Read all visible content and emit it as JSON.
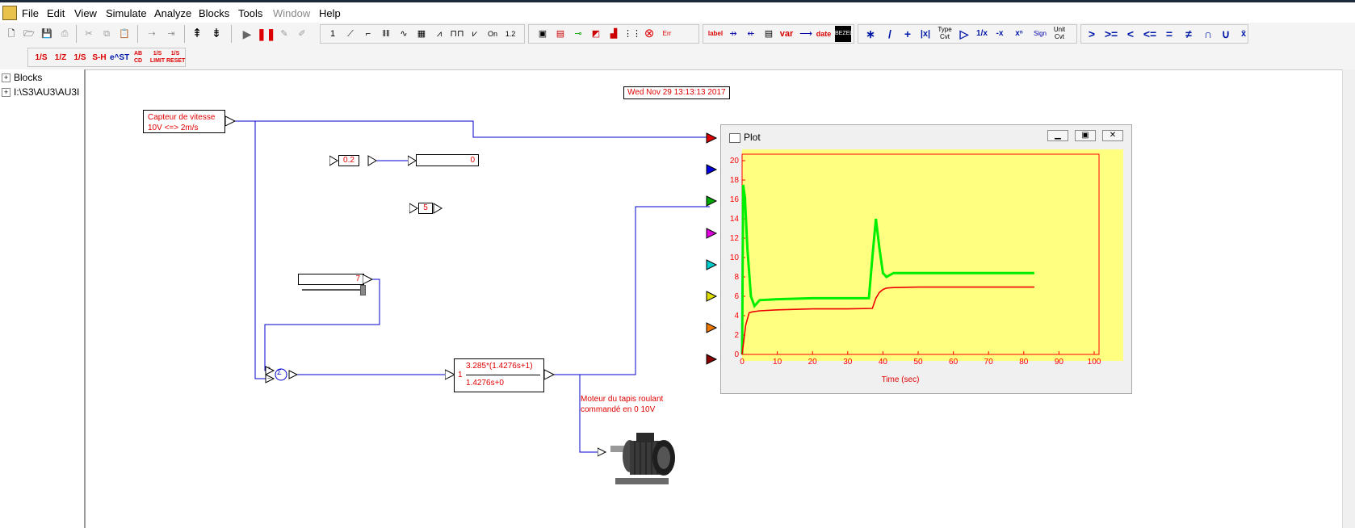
{
  "menu": {
    "items": [
      "File",
      "Edit",
      "View",
      "Simulate",
      "Analyze",
      "Blocks",
      "Tools",
      "Window",
      "Help"
    ]
  },
  "toolbar2": {
    "buttons": [
      "1/S",
      "1/Z",
      "1/S",
      "S-H",
      "e^ST",
      "AB CD",
      "1/S LIMIT",
      "1/S RESET"
    ]
  },
  "toolbar1": {
    "labels": [
      "label",
      "var",
      "date",
      "Type Cvt",
      "Sign",
      "Unit Cvt"
    ],
    "step_label": "1",
    "on_label": "On"
  },
  "tree": {
    "items": [
      {
        "label": "Blocks"
      },
      {
        "label": "I:\\S3\\AU3\\AU3I"
      }
    ]
  },
  "diagram": {
    "date_stamp": "Wed Nov 29 13:13:13 2017",
    "sensor_label_line1": "Capteur de vitesse",
    "sensor_label_line2": "10V <=> 2m/s",
    "const_a": "0.2",
    "display_value": "0",
    "const_b": "5",
    "slider_value": "7",
    "tf_prefix": "1",
    "tf_numerator": "3.285*(1.4276s+1)",
    "tf_denominator": "1.4276s+0",
    "sum_symbol": "Σ",
    "motor_label_line1": "Moteur du tapis roulant",
    "motor_label_line2": "commandé en 0 10V"
  },
  "plot": {
    "title": "Plot",
    "xlabel": "Time (sec)",
    "x_ticks": [
      "0",
      "10",
      "20",
      "30",
      "40",
      "50",
      "60",
      "70",
      "80",
      "90",
      "100"
    ],
    "y_ticks": [
      "0",
      "2",
      "4",
      "6",
      "8",
      "10",
      "12",
      "14",
      "16",
      "18",
      "20"
    ]
  },
  "colors": {
    "wire": "#0000cc",
    "plot_bg": "#ffff80",
    "plot_axis": "#ff0000",
    "series_green": "#00ee00",
    "series_red": "#ee0000",
    "port_colors": [
      "#dd0000",
      "#0000dd",
      "#00aa00",
      "#dd00dd",
      "#00cccc",
      "#dddd00",
      "#ee7700",
      "#880000"
    ]
  },
  "chart_data": {
    "type": "line",
    "xlabel": "Time (sec)",
    "xlim": [
      0,
      100
    ],
    "ylim": [
      0,
      20
    ],
    "grid": false,
    "series": [
      {
        "color": "#00ee00",
        "x": [
          0,
          0.3,
          0.8,
          1.5,
          2.5,
          3.5,
          5,
          10,
          20,
          30,
          36,
          37,
          38,
          39,
          40,
          41,
          43,
          50,
          60,
          70,
          80,
          83
        ],
        "y": [
          0,
          17.5,
          16.2,
          11.0,
          6.0,
          5.0,
          5.6,
          5.7,
          5.8,
          5.8,
          5.8,
          10.0,
          14.0,
          11.0,
          8.4,
          8.0,
          8.4,
          8.4,
          8.4,
          8.4,
          8.4,
          8.4
        ]
      },
      {
        "color": "#ee0000",
        "x": [
          0,
          1,
          2,
          3,
          5,
          10,
          20,
          30,
          37,
          38,
          39,
          40,
          41,
          43,
          50,
          60,
          70,
          80,
          83
        ],
        "y": [
          0,
          3.0,
          4.3,
          4.4,
          4.5,
          4.6,
          4.7,
          4.7,
          4.75,
          5.8,
          6.4,
          6.7,
          6.85,
          6.9,
          6.95,
          6.95,
          6.95,
          6.95,
          6.95
        ]
      }
    ]
  }
}
